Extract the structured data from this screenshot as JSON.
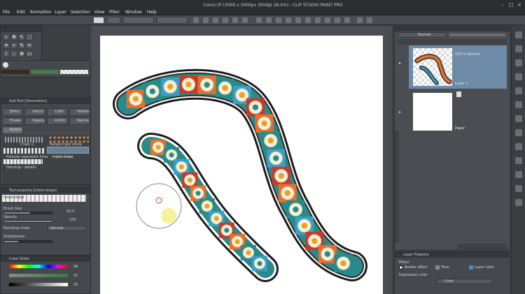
{
  "window": {
    "title": "Comic:(P (3000 x 3000px 300dpi 28.4%) - CLIP STUDIO PAINT PRO",
    "menu": [
      "File",
      "Edit",
      "Animation",
      "Layer",
      "Selection",
      "View",
      "Filter",
      "Window",
      "Help"
    ]
  },
  "sub_tool_panel": {
    "header": "Sub Tool [Decoration]",
    "tabs": [
      "Effect",
      "Hatchi",
      "Cloth",
      "Pattern",
      "Flower",
      "Vegeta",
      "Artifici",
      "Nature",
      "Ruled l"
    ],
    "brushes": [
      {
        "label": "Chain 2"
      },
      {
        "label": "Bangle-type stone"
      },
      {
        "label": "Pullover openwork lines"
      },
      {
        "label": "Inlaid stripe"
      },
      {
        "label": "Decotup - details"
      }
    ]
  },
  "tool_property": {
    "header": "Tool property [Inlaid stripe]",
    "brush_name": "Inlaid stripe",
    "rows": [
      {
        "label": "Brush Size",
        "value": "93.0"
      },
      {
        "label": "Opacity",
        "value": "100"
      },
      {
        "label": "Blending mode",
        "value": "Normal"
      },
      {
        "label": "Stabilization",
        "value": ""
      }
    ],
    "levels": [
      0.55,
      1.0,
      0.0,
      0.3
    ]
  },
  "color_slider": {
    "header": "Color Slider",
    "values": [
      "96",
      "41",
      "42"
    ],
    "levels": [
      0.96,
      0.41,
      0.42
    ]
  },
  "layers": {
    "blend_mode": "Normal",
    "items": [
      {
        "name": "100 % Normal",
        "sub": "Layer 1",
        "active": true
      },
      {
        "name": "Paper",
        "sub": "",
        "active": false
      }
    ]
  },
  "layer_property": {
    "header": "Layer Property",
    "effect_label": "Effect",
    "effects": [
      "Border effect",
      "Tone",
      "Layer color"
    ],
    "expression_label": "Expression color",
    "expression_value": "Color"
  },
  "colors": {
    "border": "#3a3a3a",
    "tile_orange": "#e8702a",
    "tile_teal": "#2a8a8a",
    "tile_blue": "#3aa0c8",
    "tile_red": "#c83a2a",
    "flower_petal": "#f4f0d8",
    "flower_center": "#f0a020",
    "selected_layer": "#6d8aa6"
  }
}
